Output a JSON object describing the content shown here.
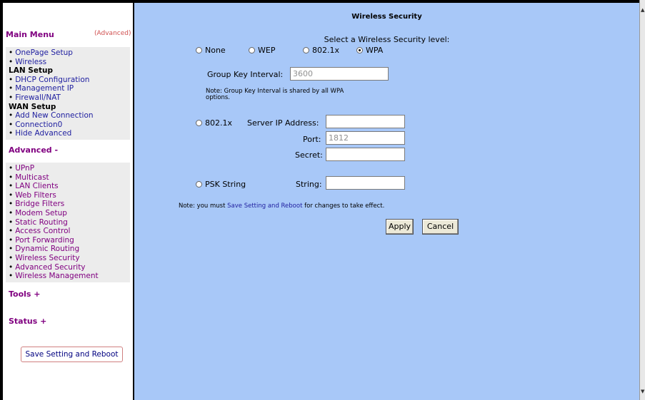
{
  "sidebar": {
    "main_menu_title": "Main Menu",
    "advanced_link": "(Advanced)",
    "main_items": [
      {
        "label": "OnePage Setup",
        "type": "link"
      },
      {
        "label": "Wireless",
        "type": "link"
      },
      {
        "label": "LAN Setup",
        "type": "header"
      },
      {
        "label": "DHCP Configuration",
        "type": "link"
      },
      {
        "label": "Management IP",
        "type": "link"
      },
      {
        "label": "Firewall/NAT",
        "type": "link"
      },
      {
        "label": "WAN Setup",
        "type": "header"
      },
      {
        "label": "Add New Connection",
        "type": "link"
      },
      {
        "label": "Connection0",
        "type": "link"
      },
      {
        "label": "Hide Advanced",
        "type": "link"
      }
    ],
    "advanced_title": "Advanced -",
    "advanced_items": [
      "UPnP",
      "Multicast",
      "LAN Clients",
      "Web Filters",
      "Bridge Filters",
      "Modem Setup",
      "Static Routing",
      "Access Control",
      "Port Forwarding",
      "Dynamic Routing",
      "Wireless Security",
      "Advanced Security",
      "Wireless Management"
    ],
    "tools_title": "Tools +",
    "status_title": "Status +",
    "save_button": "Save Setting and Reboot"
  },
  "main": {
    "page_title": "Wireless Security",
    "level_prompt": "Select a Wireless Security level:",
    "levels": [
      {
        "label": "None",
        "selected": false
      },
      {
        "label": "WEP",
        "selected": false
      },
      {
        "label": "802.1x",
        "selected": false
      },
      {
        "label": "WPA",
        "selected": true
      }
    ],
    "group_key_label": "Group Key Interval:",
    "group_key_value": "3600",
    "group_key_note_1": "Note: Group Key Interval is shared by all WPA",
    "group_key_note_2": "options.",
    "auth_8021x": {
      "label": "802.1x",
      "selected": false,
      "server_ip_label": "Server IP Address:",
      "server_ip_value": "",
      "port_label": "Port:",
      "port_value": "1812",
      "secret_label": "Secret:",
      "secret_value": ""
    },
    "psk": {
      "label": "PSK String",
      "selected": false,
      "string_label": "String:",
      "string_value": ""
    },
    "footer_note_prefix": "Note: you must ",
    "footer_note_link": "Save Setting and Reboot",
    "footer_note_suffix": " for changes to take effect.",
    "apply_button": "Apply",
    "cancel_button": "Cancel"
  }
}
